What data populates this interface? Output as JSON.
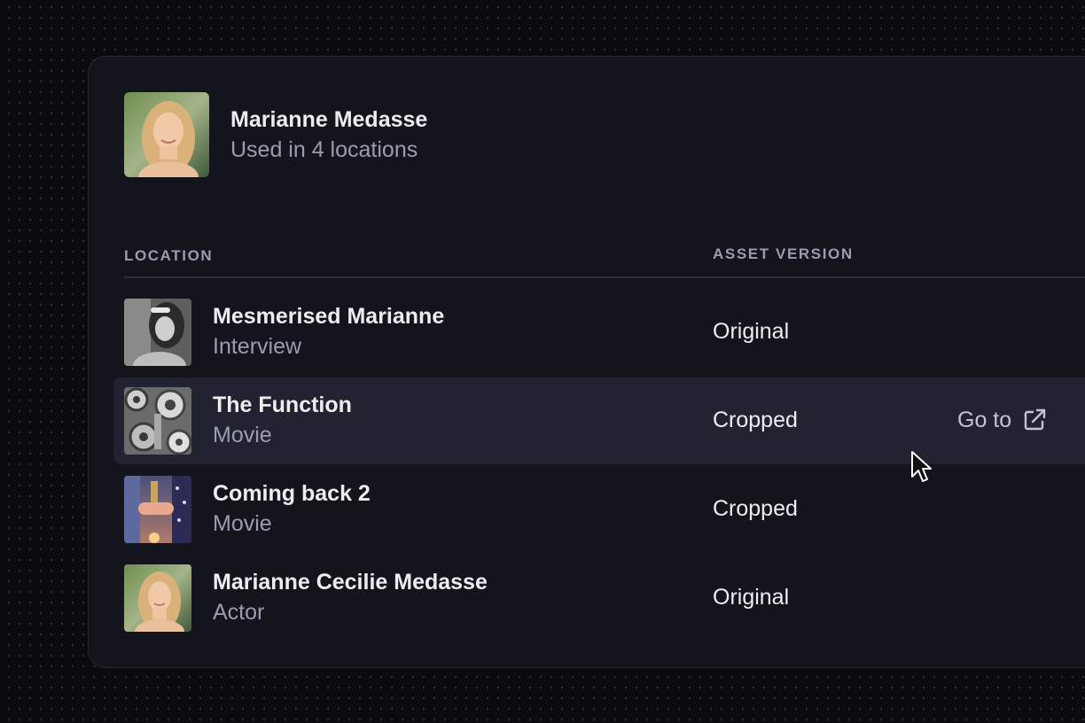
{
  "asset": {
    "name": "Marianne Medasse",
    "usage": "Used in 4 locations",
    "avatar_icon": "portrait-photo"
  },
  "columns": {
    "location": "LOCATION",
    "asset_version": "ASSET VERSION"
  },
  "rows": [
    {
      "title": "Mesmerised Marianne",
      "type": "Interview",
      "version": "Original",
      "thumb": "bw-portrait-photo"
    },
    {
      "title": "The Function",
      "type": "Movie",
      "version": "Cropped",
      "thumb": "gears-photo",
      "action": "Go to",
      "hovered": true
    },
    {
      "title": "Coming back 2",
      "type": "Movie",
      "version": "Cropped",
      "thumb": "holding-hands-photo"
    },
    {
      "title": "Marianne Cecilie Medasse",
      "type": "Actor",
      "version": "Original",
      "thumb": "portrait-photo"
    }
  ],
  "colors": {
    "panel_bg": "#13141c",
    "row_highlight": "#212330",
    "text_primary": "#ededf1",
    "text_secondary": "#9a9cb0"
  }
}
